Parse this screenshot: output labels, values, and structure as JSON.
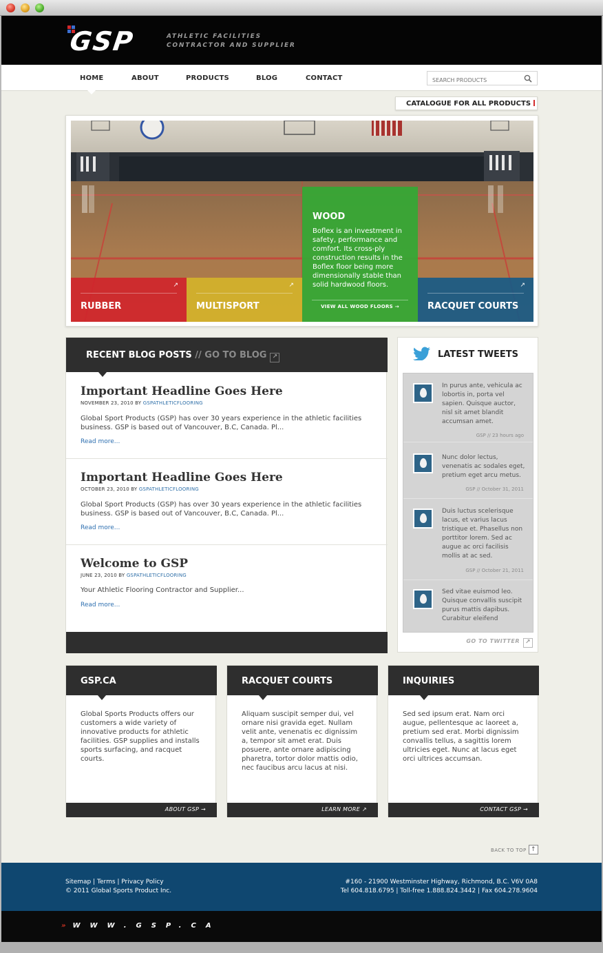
{
  "brand": {
    "logo": "GSP",
    "tagline_line1": "ATHLETIC FACILITIES",
    "tagline_line2": "CONTRACTOR AND SUPPLIER"
  },
  "nav": {
    "items": [
      "HOME",
      "ABOUT",
      "PRODUCTS",
      "BLOG",
      "CONTACT"
    ],
    "active": "HOME",
    "search_placeholder": "SEARCH PRODUCTS"
  },
  "catalogue_link": "CATALOGUE FOR ALL PRODUCTS",
  "hero": {
    "tiles": [
      {
        "label": "RUBBER",
        "color": "#d0262c"
      },
      {
        "label": "MULTISPORT",
        "color": "#d3b22b"
      },
      {
        "label": "WOOD",
        "color": "#34a835"
      },
      {
        "label": "RACQUET COURTS",
        "color": "#1a5a85"
      }
    ],
    "feature": {
      "title": "WOOD",
      "body": "Boflex is an investment in safety, performance and comfort. Its cross-ply construction results in the Boflex floor being more dimensionally stable than solid hardwood floors.",
      "link": "VIEW ALL WOOD FLOORS →"
    }
  },
  "blog": {
    "title": "RECENT BLOG POSTS",
    "goto": "// GO TO BLOG",
    "posts": [
      {
        "headline": "Important Headline Goes Here",
        "date": "NOVEMBER 23, 2010 BY",
        "author": "GSPATHLETICFLOORING",
        "excerpt": "Global Sport Products (GSP) has over 30 years experience in the athletic facilities business. GSP is based out of Vancouver, B.C, Canada. Pl...",
        "more": "Read more..."
      },
      {
        "headline": "Important Headline Goes Here",
        "date": "OCTOBER 23, 2010 BY",
        "author": "GSPATHLETICFLOORING",
        "excerpt": "Global Sport Products (GSP) has over 30 years experience in the athletic facilities business. GSP is based out of Vancouver, B.C, Canada. Pl...",
        "more": "Read more..."
      },
      {
        "headline": "Welcome to GSP",
        "date": "JUNE 23, 2010 BY",
        "author": "GSPATHLETICFLOORING",
        "excerpt": "Your Athletic Flooring Contractor and Supplier...",
        "more": "Read more..."
      }
    ]
  },
  "tweets": {
    "title": "LATEST TWEETS",
    "items": [
      {
        "text": "In purus ante, vehicula ac lobortis in, porta vel sapien. Quisque auctor, nisl sit amet blandit accumsan amet.",
        "meta": "GSP // 23 hours ago"
      },
      {
        "text": "Nunc dolor lectus, venenatis ac sodales eget, pretium eget arcu metus.",
        "meta": "GSP // October 31, 2011"
      },
      {
        "text": "Duis luctus scelerisque lacus, et varius lacus tristique et. Phasellus non porttitor lorem. Sed ac augue ac orci facilisis mollis at ac sed.",
        "meta": "GSP // October 21, 2011"
      },
      {
        "text": "Sed vitae euismod leo. Quisque convallis suscipit purus mattis dapibus. Curabitur eleifend",
        "meta": ""
      }
    ],
    "go_to": "GO TO TWITTER"
  },
  "features": [
    {
      "title": "GSP.CA",
      "body": "Global Sports Products offers our customers a wide variety of innovative products for athletic facilities. GSP supplies and installs sports surfacing, and racquet courts.",
      "link": "ABOUT GSP →"
    },
    {
      "title": "RACQUET COURTS",
      "body": "Aliquam suscipit semper dui, vel ornare nisi gravida eget. Nullam velit ante, venenatis ec dignissim a, tempor sit amet erat. Duis posuere, ante ornare adipiscing pharetra, tortor dolor mattis odio, nec faucibus arcu lacus at nisi.",
      "link": "LEARN MORE ↗"
    },
    {
      "title": "INQUIRIES",
      "body": "Sed sed ipsum erat. Nam orci augue, pellentesque ac laoreet a, pretium sed erat. Morbi dignissim convallis tellus, a sagittis lorem ultricies eget. Nunc at lacus eget orci ultrices accumsan.",
      "link": "CONTACT GSP →"
    }
  ],
  "back_to_top": "BACK TO TOP",
  "footer": {
    "links": "Sitemap  |  Terms  |  Privacy Policy",
    "copyright": "© 2011 Global Sports Product Inc.",
    "address": "#160 - 21900 Westminster Highway, Richmond, B.C.  V6V 0A8",
    "phones": "Tel 604.818.6795  |  Toll-free 1.888.824.3442  |  Fax 604.278.9604",
    "url": "WWW.GSP.CA",
    "url_chevrons": "»"
  }
}
